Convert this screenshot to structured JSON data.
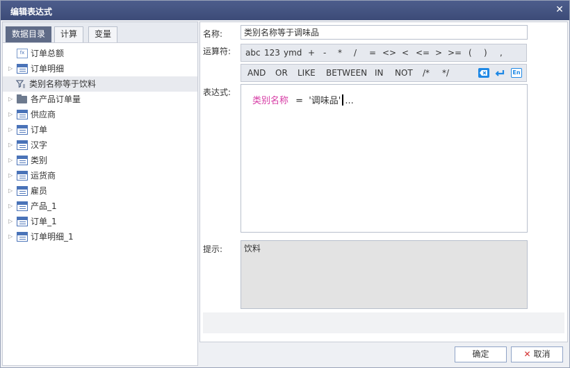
{
  "window": {
    "title": "编辑表达式"
  },
  "tabs": [
    {
      "label": "数据目录",
      "active": true
    },
    {
      "label": "计算",
      "active": false
    },
    {
      "label": "变量",
      "active": false
    }
  ],
  "tree": [
    {
      "label": "订单总额",
      "icon": "calc-field-icon",
      "expandable": false,
      "selected": false
    },
    {
      "label": "订单明细",
      "icon": "table-icon",
      "expandable": true,
      "selected": false
    },
    {
      "label": "类别名称等于饮料",
      "icon": "filter-icon",
      "expandable": false,
      "selected": true
    },
    {
      "label": "各产品订单量",
      "icon": "folder-icon",
      "expandable": true,
      "selected": false
    },
    {
      "label": "供应商",
      "icon": "table-icon",
      "expandable": true,
      "selected": false
    },
    {
      "label": "订单",
      "icon": "table-icon",
      "expandable": true,
      "selected": false
    },
    {
      "label": "汉字",
      "icon": "table-icon",
      "expandable": true,
      "selected": false
    },
    {
      "label": "类别",
      "icon": "table-icon",
      "expandable": true,
      "selected": false
    },
    {
      "label": "运货商",
      "icon": "table-icon",
      "expandable": true,
      "selected": false
    },
    {
      "label": "雇员",
      "icon": "table-icon",
      "expandable": true,
      "selected": false
    },
    {
      "label": "产品_1",
      "icon": "table-icon",
      "expandable": true,
      "selected": false
    },
    {
      "label": "订单_1",
      "icon": "table-icon",
      "expandable": true,
      "selected": false
    },
    {
      "label": "订单明细_1",
      "icon": "table-icon",
      "expandable": true,
      "selected": false
    }
  ],
  "form": {
    "name_label": "名称:",
    "name_value": "类别名称等于调味品",
    "operator_label": "运算符:",
    "expression_label": "表达式:",
    "hint_label": "提示:",
    "hint_text": "饮料"
  },
  "operators_row1": [
    "abc",
    "123",
    "ymd",
    "+",
    "-",
    "*",
    "/",
    "=",
    "<>",
    "<",
    "<=",
    ">",
    ">=",
    "(",
    ")",
    ","
  ],
  "operators_row2": [
    "AND",
    "OR",
    "LIKE",
    "BETWEEN",
    "IN",
    "NOT",
    "/*",
    "*/"
  ],
  "operator_icons": [
    "clear-icon",
    "enter-icon",
    "language-icon"
  ],
  "operator_icon_text": {
    "language": "En"
  },
  "expression": {
    "field": "类别名称",
    "operator": "=",
    "value": "'调味品'",
    "suffix": "..."
  },
  "buttons": {
    "ok": "确定",
    "cancel": "取消"
  },
  "colors": {
    "title_bar": "#3f4e7a",
    "field_highlight": "#d63aa4",
    "tab_active": "#5f6b87",
    "icon_blue": "#1e88e5",
    "cancel_red": "#d32f2f"
  }
}
